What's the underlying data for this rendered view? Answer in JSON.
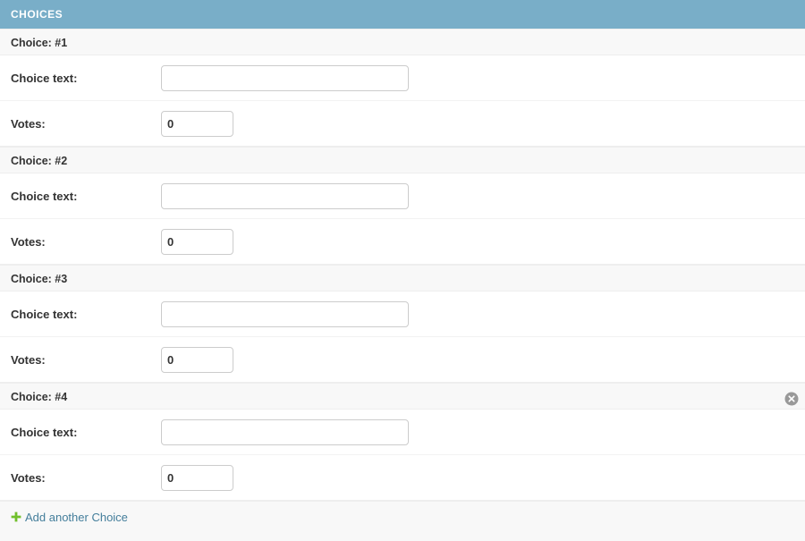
{
  "module": {
    "title": "CHOICES",
    "header_color": "#79aec8"
  },
  "inlines": [
    {
      "heading": "Choice: #1",
      "has_delete": false,
      "delete_icon": "delete-circle-icon",
      "fields": {
        "choice_text_label": "Choice text:",
        "choice_text_value": "",
        "votes_label": "Votes:",
        "votes_value": "0"
      }
    },
    {
      "heading": "Choice: #2",
      "has_delete": false,
      "delete_icon": "delete-circle-icon",
      "fields": {
        "choice_text_label": "Choice text:",
        "choice_text_value": "",
        "votes_label": "Votes:",
        "votes_value": "0"
      }
    },
    {
      "heading": "Choice: #3",
      "has_delete": false,
      "delete_icon": "delete-circle-icon",
      "fields": {
        "choice_text_label": "Choice text:",
        "choice_text_value": "",
        "votes_label": "Votes:",
        "votes_value": "0"
      }
    },
    {
      "heading": "Choice: #4",
      "has_delete": true,
      "delete_icon": "delete-circle-icon",
      "fields": {
        "choice_text_label": "Choice text:",
        "choice_text_value": "",
        "votes_label": "Votes:",
        "votes_value": "0"
      }
    }
  ],
  "add_row": {
    "icon": "plus-icon",
    "icon_color": "#70bf2b",
    "label": "Add another Choice",
    "link_color": "#447e9b"
  }
}
